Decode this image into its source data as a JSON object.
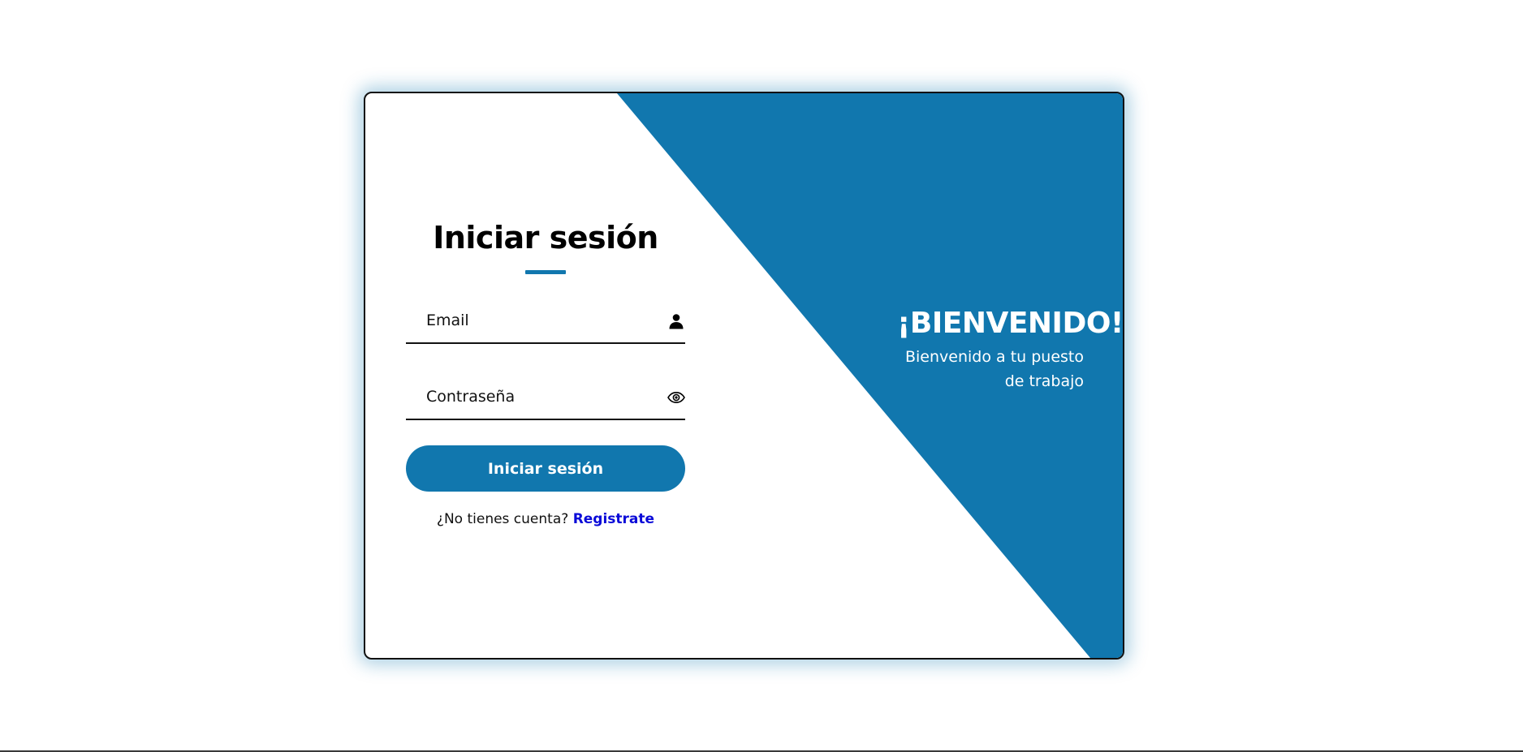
{
  "login": {
    "title": "Iniciar sesión",
    "email_placeholder": "Email",
    "password_placeholder": "Contraseña",
    "submit_label": "Iniciar sesión",
    "no_account_text": "¿No tienes cuenta?",
    "register_link": "Registrate"
  },
  "welcome": {
    "title": "¡BIENVENIDO!",
    "subtitle": "Bienvenido a tu puesto de trabajo"
  },
  "icons": {
    "email_field": "user-icon",
    "password_field": "eye-icon"
  },
  "colors": {
    "accent": "#1177ae",
    "link": "#0a0ad8",
    "text": "#111111",
    "background": "#ffffff"
  }
}
